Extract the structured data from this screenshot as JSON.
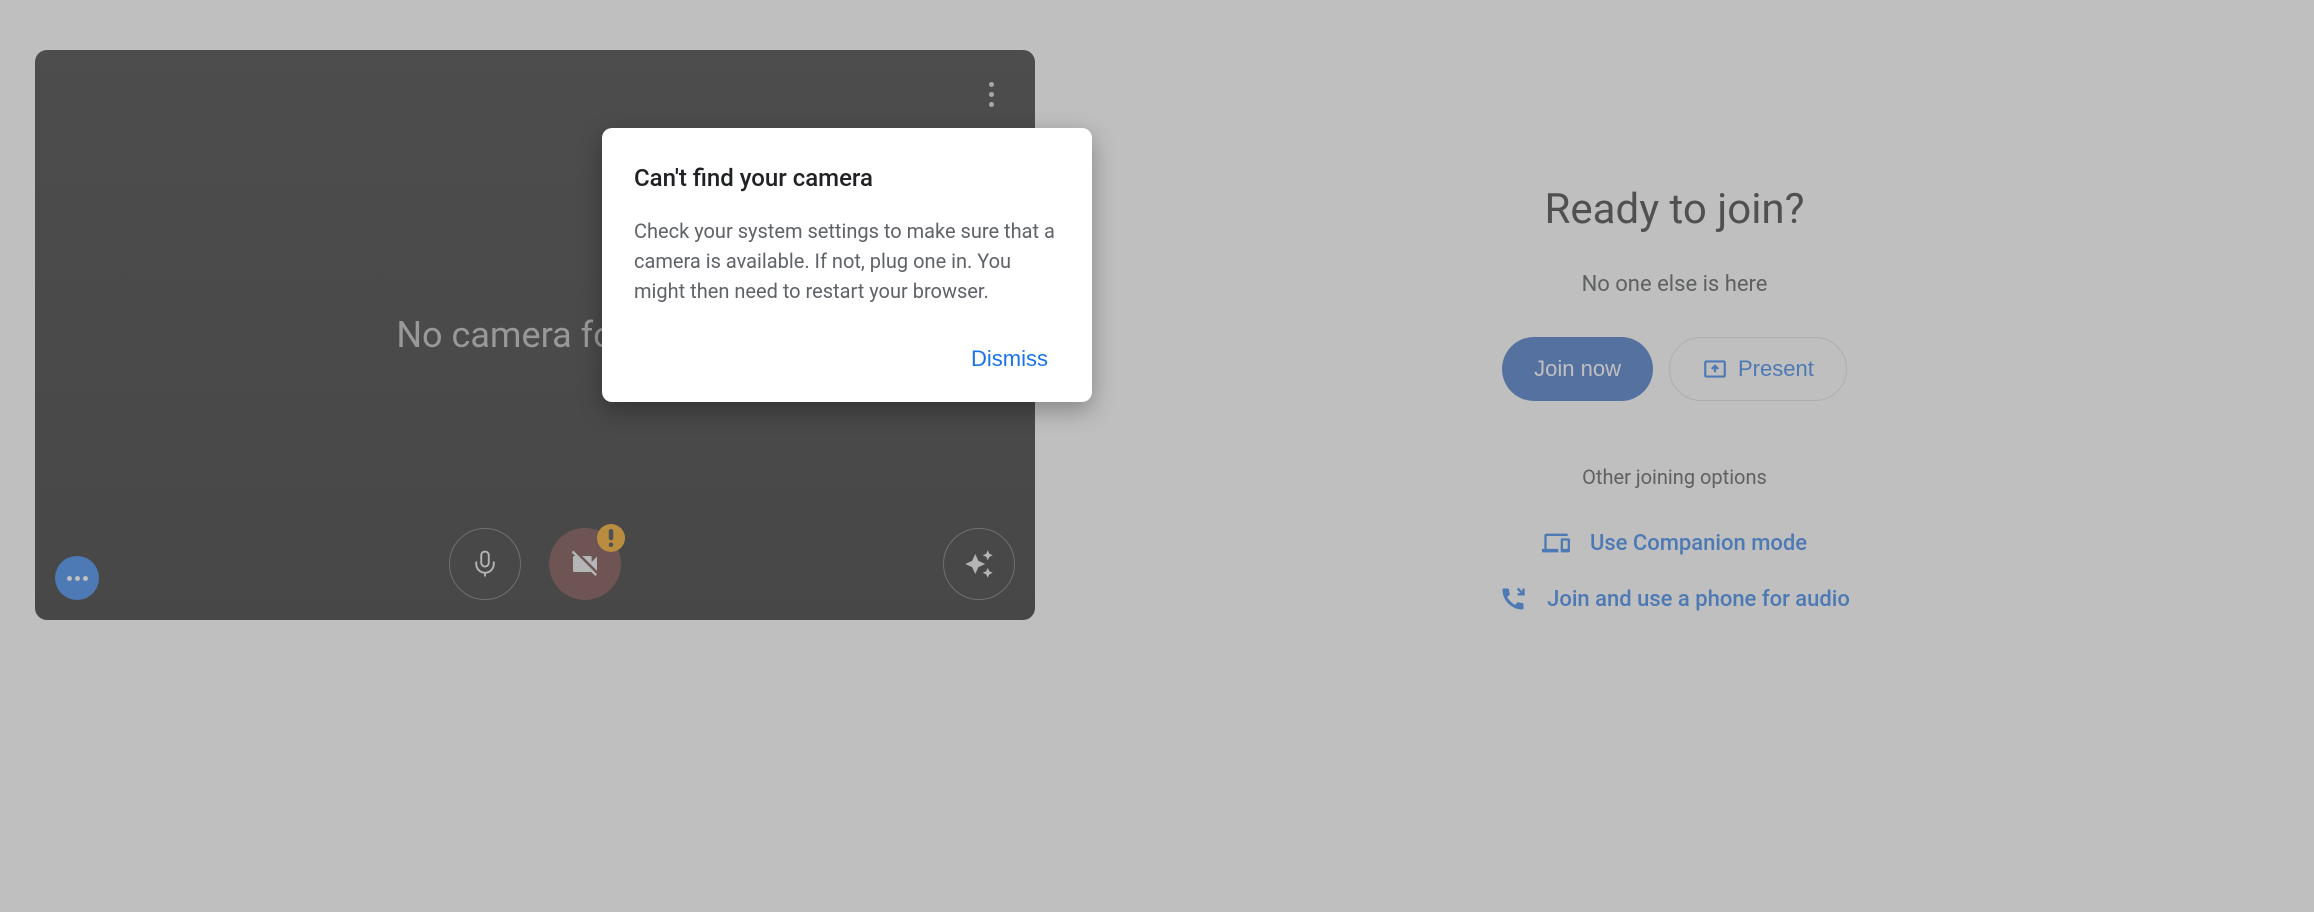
{
  "preview": {
    "status_text": "No camera found"
  },
  "dialog": {
    "title": "Can't find your camera",
    "body": "Check your system settings to make sure that a camera is available. If not, plug one in. You might then need to restart your browser.",
    "dismiss": "Dismiss"
  },
  "join": {
    "title": "Ready to join?",
    "status": "No one else is here",
    "join_now": "Join now",
    "present": "Present",
    "other_options": "Other joining options",
    "companion": "Use Companion mode",
    "phone": "Join and use a phone for audio"
  }
}
